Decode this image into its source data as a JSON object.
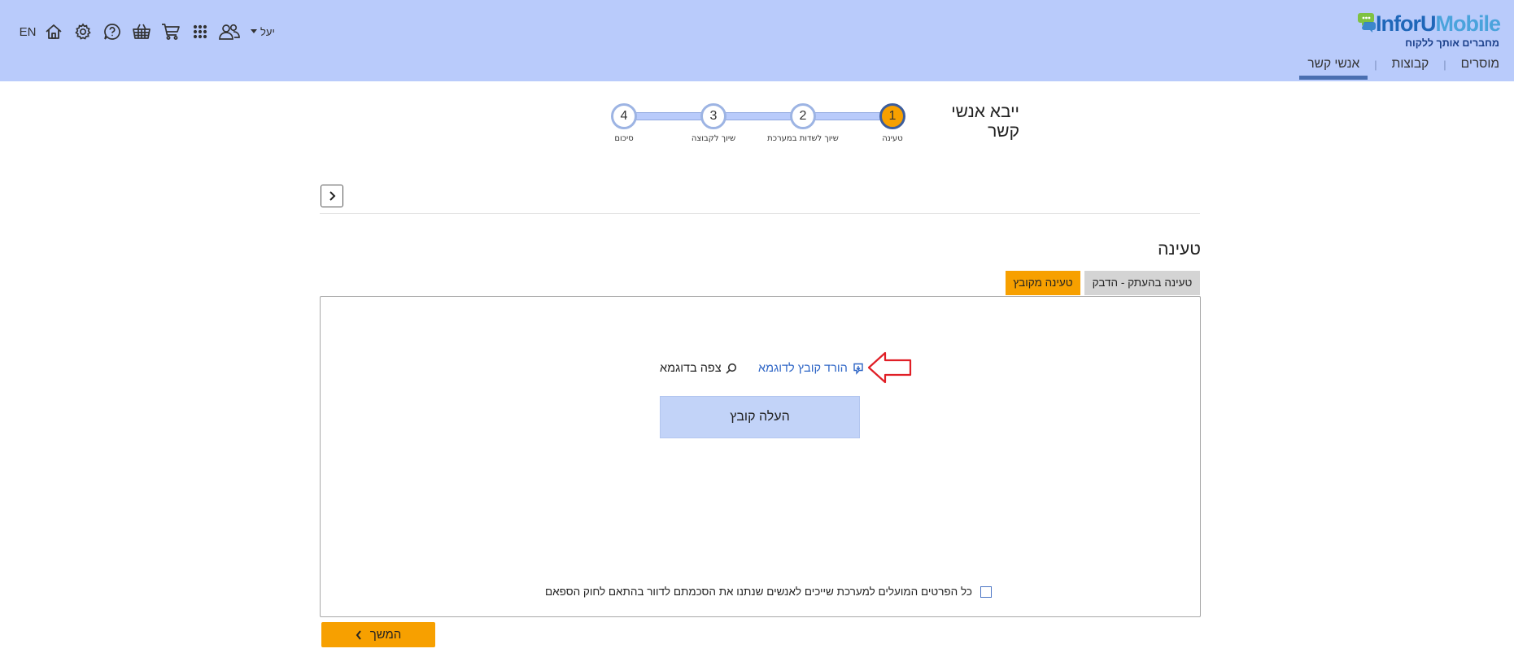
{
  "header": {
    "logo": {
      "text_part1": "InforU",
      "text_part2": "Mobile",
      "tagline": "מחברים אותך ללקוח"
    },
    "nav": [
      {
        "label": "אנשי קשר",
        "active": true
      },
      {
        "label": "קבוצות",
        "active": false
      },
      {
        "label": "מוסרים",
        "active": false
      }
    ],
    "user_name": "יעל",
    "lang": "EN",
    "icons": [
      "home-icon",
      "gear-icon",
      "help-icon",
      "basket-icon",
      "cart-icon",
      "apps-grid-icon",
      "users-icon"
    ],
    "accent_color": "#b9cbfb"
  },
  "wizard": {
    "title": "ייבא אנשי קשר",
    "steps": [
      {
        "number": "1",
        "label": "טעינה",
        "active": true
      },
      {
        "number": "2",
        "label": "שיוך לשדות במערכת",
        "active": false
      },
      {
        "number": "3",
        "label": "שיוך לקבוצה",
        "active": false
      },
      {
        "number": "4",
        "label": "סיכום",
        "active": false
      }
    ],
    "active_color": "#f7a000"
  },
  "section": {
    "title": "טעינה",
    "tabs": {
      "from_file": "טעינה מקובץ",
      "paste": "טעינה בהעתק - הדבק"
    }
  },
  "upload": {
    "download_sample": "הורד קובץ לדוגמא",
    "view_sample": "צפה בדוגמא",
    "upload_button": "העלה קובץ",
    "consent_text": "כל הפרטים המועלים למערכת שייכים לאנשים שנתנו את הסכמתם לדוור בהתאם לחוק הספאם"
  },
  "footer": {
    "next_button": "המשך"
  }
}
